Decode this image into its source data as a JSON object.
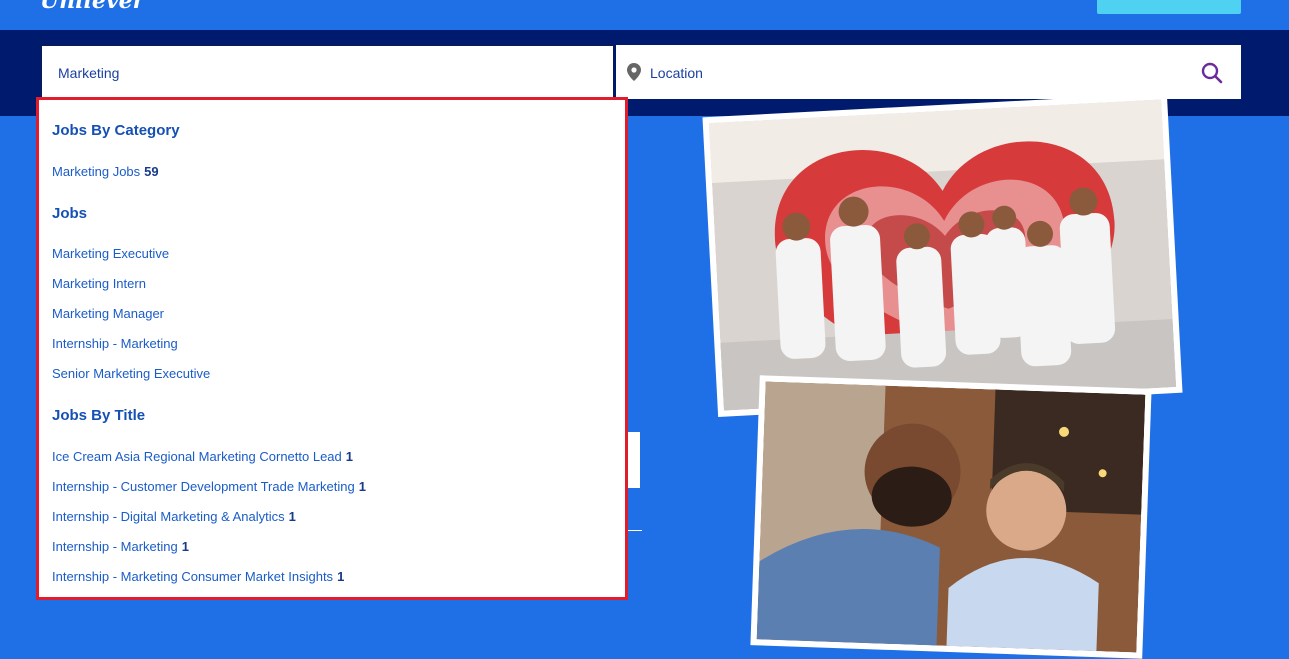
{
  "header": {
    "logo_text": "Unilever"
  },
  "search": {
    "keyword_value": "Marketing",
    "location_placeholder": "Location"
  },
  "icons": {
    "location": "map-pin-icon",
    "search": "search-icon"
  },
  "dropdown": {
    "category_heading": "Jobs By Category",
    "categories": [
      {
        "label": "Marketing Jobs",
        "count": "59"
      }
    ],
    "jobs_heading": "Jobs",
    "jobs": [
      "Marketing Executive",
      "Marketing Intern",
      "Marketing Manager",
      "Internship - Marketing",
      "Senior Marketing Executive"
    ],
    "titles_heading": "Jobs By Title",
    "titles": [
      {
        "label": "Ice Cream Asia Regional Marketing Cornetto Lead",
        "count": "1"
      },
      {
        "label": "Internship - Customer Development Trade Marketing",
        "count": "1"
      },
      {
        "label": "Internship - Digital Marketing & Analytics",
        "count": "1"
      },
      {
        "label": "Internship - Marketing",
        "count": "1"
      },
      {
        "label": "Internship - Marketing Consumer Market Insights",
        "count": "1"
      }
    ]
  },
  "colors": {
    "brand_blue": "#1f6fe6",
    "navy_band": "#001b6e",
    "highlight_border": "#e11d2d",
    "link_blue": "#1a5cc8"
  }
}
